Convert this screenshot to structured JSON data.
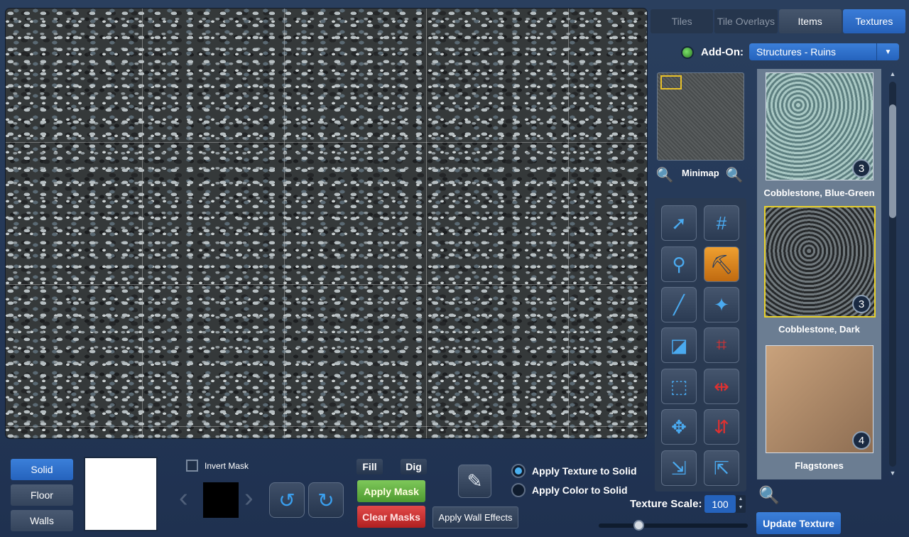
{
  "tabs": [
    {
      "label": "Tiles"
    },
    {
      "label": "Tile Overlays"
    },
    {
      "label": "Items"
    },
    {
      "label": "Textures"
    }
  ],
  "addon": {
    "label": "Add-On:",
    "selected": "Structures - Ruins"
  },
  "minimap": {
    "label": "Minimap"
  },
  "textures": [
    {
      "name": "Cobblestone, Blue-Green",
      "count": "3",
      "color": "#7fa8a4"
    },
    {
      "name": "Cobblestone, Dark",
      "count": "3",
      "color": "#3b3f41"
    },
    {
      "name": "Flagstones",
      "count": "4",
      "color": "#b08a66"
    }
  ],
  "layers": {
    "solid": "Solid",
    "floor": "Floor",
    "walls": "Walls"
  },
  "mask": {
    "invert_label": "Invert Mask",
    "fill": "Fill",
    "dig": "Dig",
    "apply": "Apply Mask",
    "clear": "Clear Masks",
    "wall_effects": "Apply Wall Effects"
  },
  "apply_mode": {
    "texture": "Apply Texture to Solid",
    "color": "Apply Color to Solid",
    "selected": "texture"
  },
  "scale": {
    "label": "Texture Scale:",
    "value": "100"
  },
  "update_label": "Update Texture"
}
